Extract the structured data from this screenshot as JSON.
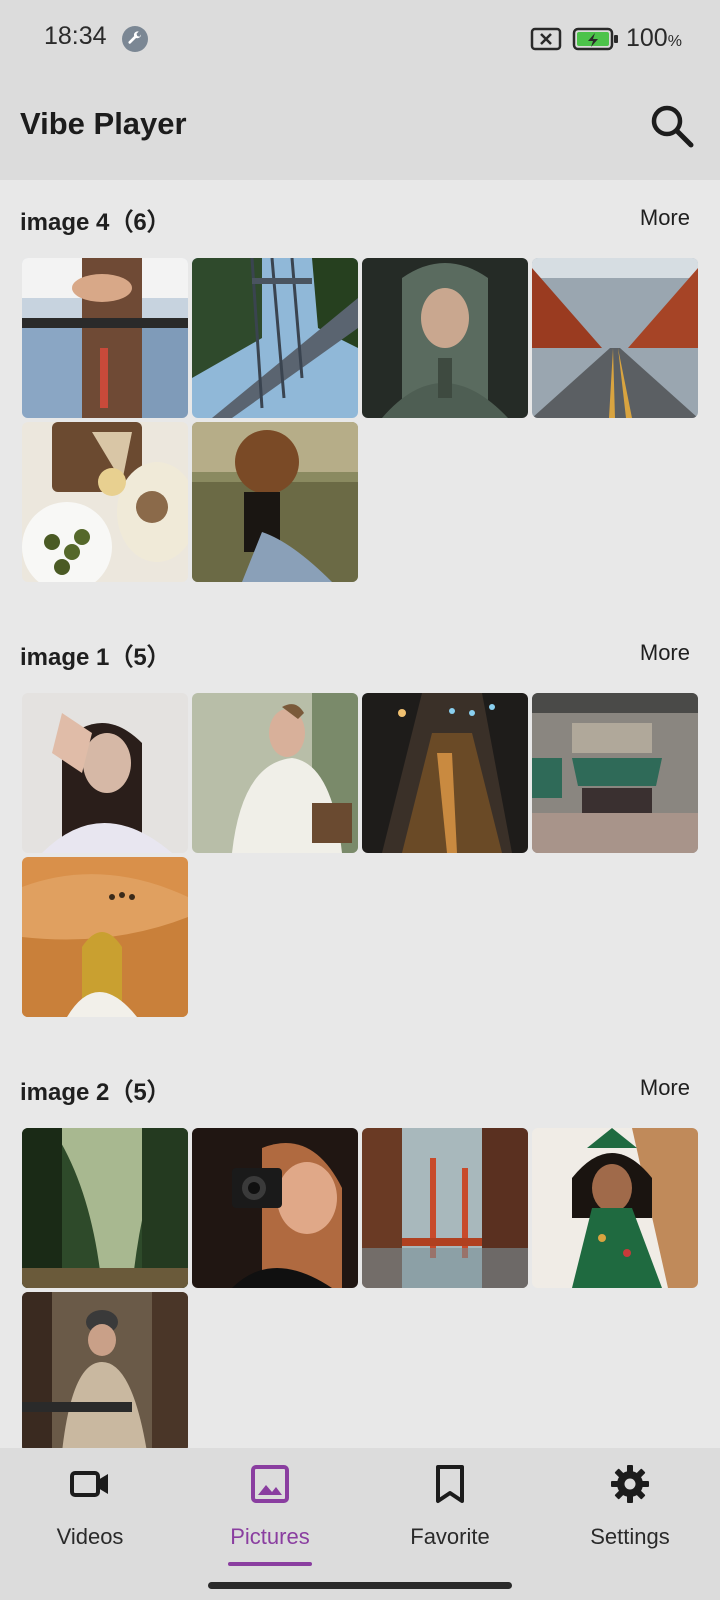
{
  "status_bar": {
    "time": "18:34",
    "battery": "100",
    "battery_unit": "%",
    "icons": [
      "wrench-icon",
      "no-sim-icon",
      "battery-charging-icon"
    ]
  },
  "app_bar": {
    "title": "Vibe Player",
    "search_icon": "search-icon"
  },
  "sections": [
    {
      "title": "image 4（6）",
      "more_label": "More",
      "thumbnails": [
        {
          "subject": "hands-jeans",
          "colors": [
            "#b9c7d6",
            "#6f4a35",
            "#f2f2f2"
          ]
        },
        {
          "subject": "bridge",
          "colors": [
            "#8ab4d8",
            "#2f4a2c",
            "#6b7682"
          ]
        },
        {
          "subject": "hooded-girl",
          "colors": [
            "#303a33",
            "#5a6b5f",
            "#c9a78f"
          ]
        },
        {
          "subject": "autumn-road",
          "colors": [
            "#9a3b20",
            "#5b5f63",
            "#d9a440"
          ]
        },
        {
          "subject": "food-table",
          "colors": [
            "#f4f0e8",
            "#5a6b2c",
            "#8b6a4a"
          ]
        },
        {
          "subject": "curly-hair-field",
          "colors": [
            "#6b6a45",
            "#3a2a1e",
            "#a89a78"
          ]
        }
      ]
    },
    {
      "title": "image 1（5）",
      "more_label": "More",
      "thumbnails": [
        {
          "subject": "woman-hand",
          "colors": [
            "#e6e4e2",
            "#2a1e1a",
            "#d6b8a6"
          ]
        },
        {
          "subject": "man-white-shirt",
          "colors": [
            "#c9ccc0",
            "#f0efe8",
            "#5a5a4a"
          ]
        },
        {
          "subject": "night-street",
          "colors": [
            "#1e1c1a",
            "#c98a40",
            "#4a8aa8"
          ]
        },
        {
          "subject": "storefront",
          "colors": [
            "#8a8680",
            "#2f6a58",
            "#5a4a3a"
          ]
        },
        {
          "subject": "desert",
          "colors": [
            "#d9904a",
            "#c9a030",
            "#f2f0ea"
          ]
        }
      ]
    },
    {
      "title": "image 2（5）",
      "more_label": "More",
      "thumbnails": [
        {
          "subject": "forest",
          "colors": [
            "#2e4a2a",
            "#a8b890",
            "#1a2a16"
          ]
        },
        {
          "subject": "photographer",
          "colors": [
            "#2a1a14",
            "#b06a40",
            "#1a1a1a"
          ]
        },
        {
          "subject": "golden-gate",
          "colors": [
            "#6a3a24",
            "#c84a2a",
            "#8aa0a8"
          ]
        },
        {
          "subject": "girl-tree-costume",
          "colors": [
            "#f0ece6",
            "#1f6a40",
            "#c08a5a"
          ]
        },
        {
          "subject": "man-forest",
          "colors": [
            "#6a5a48",
            "#3a3a3a",
            "#c9b8a0"
          ]
        }
      ]
    }
  ],
  "bottom_nav": {
    "items": [
      {
        "label": "Videos",
        "icon": "video-camera-icon",
        "active": false
      },
      {
        "label": "Pictures",
        "icon": "image-icon",
        "active": true
      },
      {
        "label": "Favorite",
        "icon": "bookmark-icon",
        "active": false
      },
      {
        "label": "Settings",
        "icon": "gear-icon",
        "active": false
      }
    ],
    "accent_color": "#8a3ea0"
  }
}
